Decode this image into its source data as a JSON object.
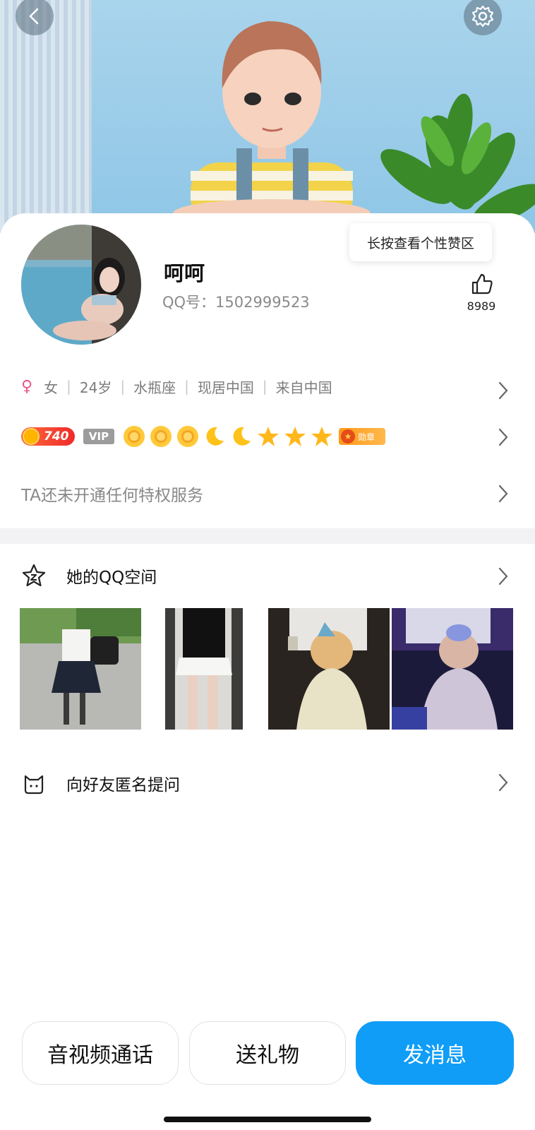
{
  "header": {
    "back_icon": "chevron-left-icon",
    "settings_icon": "gear-icon"
  },
  "profile": {
    "nickname": "呵呵",
    "qq_number": "QQ号：1502999523",
    "tooltip": "长按查看个性赞区",
    "like_icon": "thumbs-up-icon",
    "like_count": "8989"
  },
  "info": {
    "gender_icon": "female-icon",
    "gender": "女",
    "age": "24岁",
    "zodiac": "水瓶座",
    "current_location": "现居中国",
    "hometown": "来自中国"
  },
  "badges": {
    "level": "740",
    "vip": "VIP",
    "level_icons": [
      "sun",
      "sun",
      "sun",
      "moon",
      "moon",
      "star",
      "star",
      "star"
    ],
    "medal": "勋章"
  },
  "privilege": {
    "text": "TA还未开通任何特权服务"
  },
  "qzone": {
    "icon": "star-face-icon",
    "label": "她的QQ空间"
  },
  "ask": {
    "icon": "cat-icon",
    "label": "向好友匿名提问"
  },
  "actions": {
    "call": "音视频通话",
    "gift": "送礼物",
    "message": "发消息"
  },
  "colors": {
    "primary": "#0f9df7",
    "level_pill": "#ee2a2a",
    "female": "#e8558a"
  }
}
